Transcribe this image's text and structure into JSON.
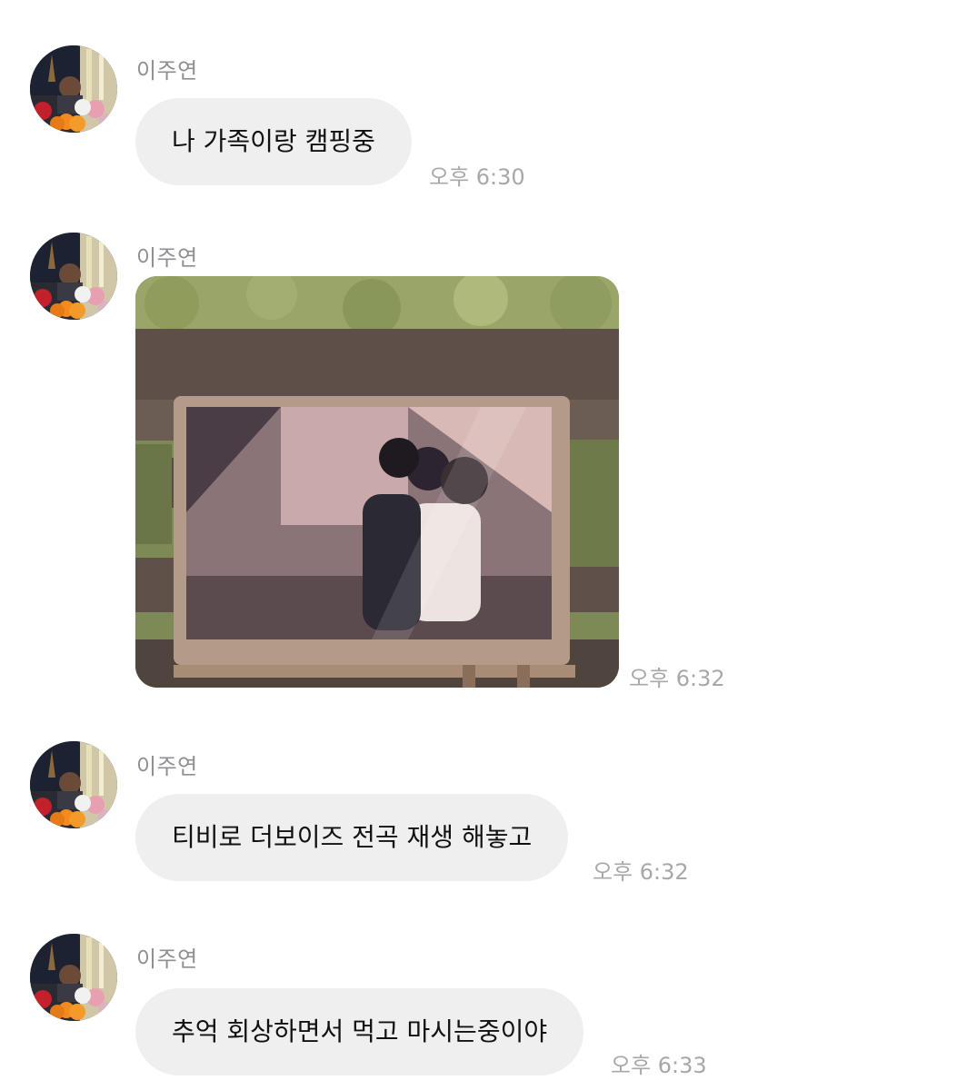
{
  "messages": [
    {
      "sender": "이주연",
      "type": "text",
      "text": "나 가족이랑 캠핑중",
      "time": "오후 6:30",
      "avatar_icon": "profile-photo"
    },
    {
      "sender": "이주연",
      "type": "image",
      "image_icon": "photo-tv-on-easel-outdoors",
      "time": "오후 6:32",
      "avatar_icon": "profile-photo"
    },
    {
      "sender": "이주연",
      "type": "text",
      "text": "티비로 더보이즈 전곡 재생 해놓고",
      "time": "오후 6:32",
      "avatar_icon": "profile-photo"
    },
    {
      "sender": "이주연",
      "type": "text",
      "text": "추억 회상하면서 먹고 마시는중이야",
      "time": "오후 6:33",
      "avatar_icon": "profile-photo"
    }
  ],
  "colors": {
    "bubble_bg": "#efefef",
    "sender_text": "#8e8e93",
    "time_text": "#a8a8a8",
    "message_text": "#111111"
  }
}
